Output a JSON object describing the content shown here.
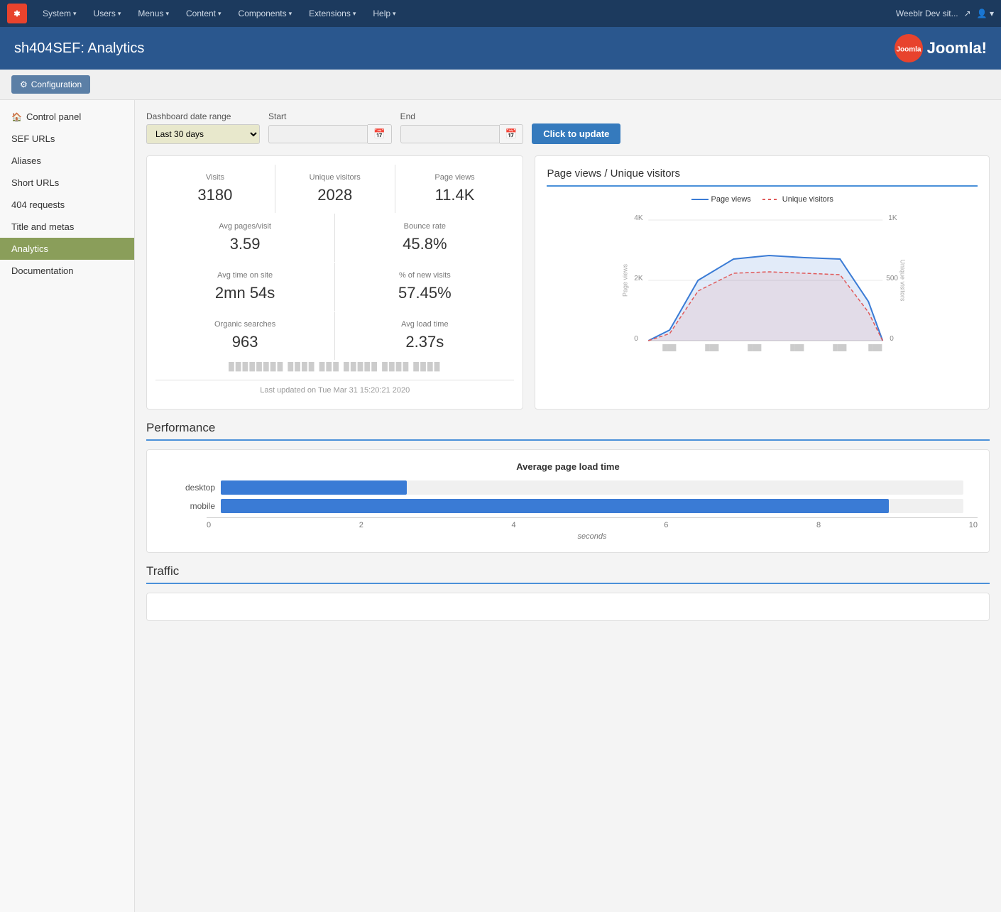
{
  "topnav": {
    "items": [
      {
        "label": "System",
        "id": "system"
      },
      {
        "label": "Users",
        "id": "users"
      },
      {
        "label": "Menus",
        "id": "menus"
      },
      {
        "label": "Content",
        "id": "content"
      },
      {
        "label": "Components",
        "id": "components"
      },
      {
        "label": "Extensions",
        "id": "extensions"
      },
      {
        "label": "Help",
        "id": "help"
      }
    ],
    "site_name": "Weeblr Dev sit...",
    "user_icon": "👤"
  },
  "header": {
    "title": "sh404SEF: Analytics",
    "joomla_text": "Joomla!"
  },
  "toolbar": {
    "config_label": "Configuration"
  },
  "sidebar": {
    "items": [
      {
        "label": "Control panel",
        "id": "control-panel",
        "icon": "🏠",
        "active": false
      },
      {
        "label": "SEF URLs",
        "id": "sef-urls",
        "icon": "",
        "active": false
      },
      {
        "label": "Aliases",
        "id": "aliases",
        "icon": "",
        "active": false
      },
      {
        "label": "Short URLs",
        "id": "short-urls",
        "icon": "",
        "active": false
      },
      {
        "label": "404 requests",
        "id": "404-requests",
        "icon": "",
        "active": false
      },
      {
        "label": "Title and metas",
        "id": "title-metas",
        "icon": "",
        "active": false
      },
      {
        "label": "Analytics",
        "id": "analytics",
        "icon": "",
        "active": true
      },
      {
        "label": "Documentation",
        "id": "documentation",
        "icon": "",
        "active": false
      }
    ]
  },
  "dashboard": {
    "date_range_label": "Dashboard date range",
    "start_label": "Start",
    "end_label": "End",
    "update_button": "Click to update",
    "date_range_placeholder": "Last 30 days",
    "start_placeholder": "",
    "end_placeholder": ""
  },
  "stats": {
    "visits_label": "Visits",
    "visits_value": "3180",
    "unique_visitors_label": "Unique visitors",
    "unique_visitors_value": "2028",
    "page_views_label": "Page views",
    "page_views_value": "11.4K",
    "avg_pages_label": "Avg pages/visit",
    "avg_pages_value": "3.59",
    "bounce_rate_label": "Bounce rate",
    "bounce_rate_value": "45.8%",
    "avg_time_label": "Avg time on site",
    "avg_time_value": "2mn 54s",
    "new_visits_label": "% of new visits",
    "new_visits_value": "57.45%",
    "organic_label": "Organic searches",
    "organic_value": "963",
    "avg_load_label": "Avg load time",
    "avg_load_value": "2.37s",
    "last_updated": "Last updated on Tue Mar 31 15:20:21 2020"
  },
  "chart": {
    "title": "Page views / Unique visitors",
    "legend_page_views": "Page views",
    "legend_unique_visitors": "Unique visitors",
    "y_left_max": "4K",
    "y_left_mid": "2K",
    "y_left_min": "0",
    "y_right_max": "1K",
    "y_right_mid": "500",
    "y_right_min": "0",
    "y_left_label": "Page views",
    "y_right_label": "Unique visitors"
  },
  "performance": {
    "section_title": "Performance",
    "chart_title": "Average page load time",
    "bars": [
      {
        "label": "desktop",
        "value": 2.5,
        "max": 10
      },
      {
        "label": "mobile",
        "value": 9.0,
        "max": 10
      }
    ],
    "x_axis_ticks": [
      "0",
      "2",
      "4",
      "6",
      "8",
      "10"
    ],
    "x_axis_label": "seconds"
  },
  "traffic": {
    "section_title": "Traffic"
  }
}
